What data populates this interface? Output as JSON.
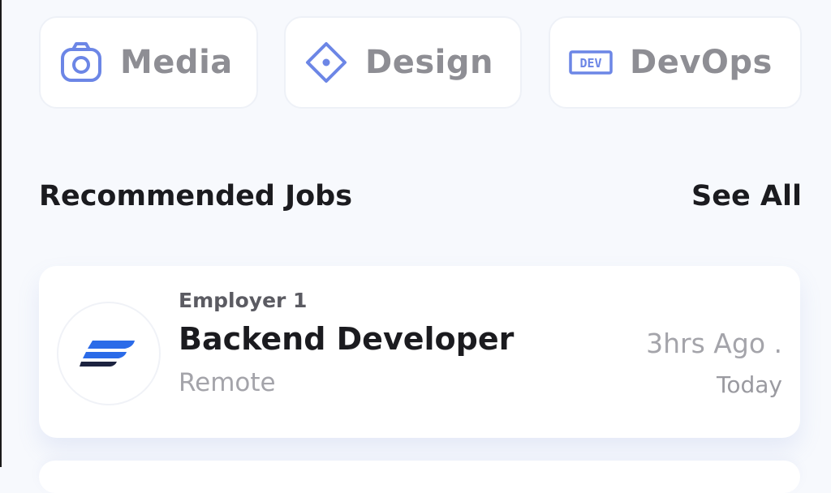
{
  "categories": [
    {
      "label": "Media",
      "icon": "camera-icon"
    },
    {
      "label": "Design",
      "icon": "design-diamond-icon"
    },
    {
      "label": "DevOps",
      "icon": "dev-badge-icon"
    }
  ],
  "dev_badge_text": "DEV",
  "section": {
    "title": "Recommended Jobs",
    "see_all_label": "See All"
  },
  "jobs": [
    {
      "employer": "Employer 1",
      "title": "Backend Developer",
      "location": "Remote",
      "time": "3hrs Ago .",
      "day": "Today",
      "logo": "company-logo"
    }
  ],
  "colors": {
    "background": "#f7f9fd",
    "accent_icon": "#6c86e6",
    "logo_blue": "#2b6be8",
    "logo_dark": "#1c2340",
    "chip_text": "#8e8e94"
  }
}
